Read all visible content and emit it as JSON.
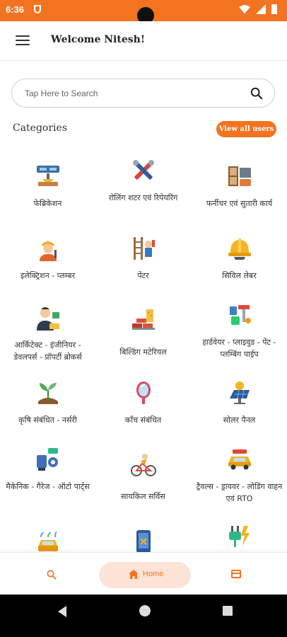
{
  "status": {
    "time": "6:36"
  },
  "header": {
    "title": "Welcome Nitesh!"
  },
  "search": {
    "placeholder": "Tap Here to Search"
  },
  "categories": {
    "title": "Categories",
    "view_all": "View all users",
    "items": [
      {
        "label": "फेब्रिकेशन",
        "icon": "fabrication-icon"
      },
      {
        "label": "रोलिंग शटर एवं रिपेयरिंग",
        "icon": "tools-icon"
      },
      {
        "label": "फर्नीचर एवं सुतारी कार्य",
        "icon": "furniture-icon"
      },
      {
        "label": "इलेक्ट्रिशन - प्लम्बर",
        "icon": "electrician-icon"
      },
      {
        "label": "पेंटर",
        "icon": "painter-icon"
      },
      {
        "label": "सिविल लेबर",
        "icon": "helmet-icon"
      },
      {
        "label": "आर्किटेक्ट - इंजीनियर - डेवलपर्स - प्रॉपर्टी ब्रोकर्स",
        "icon": "architect-icon"
      },
      {
        "label": "बिल्डिंग मटेरियल",
        "icon": "bricks-icon"
      },
      {
        "label": "हार्डवेयर - प्लाइवुड - पेंट - प्लम्बिंग पाईप",
        "icon": "hardware-icon"
      },
      {
        "label": "कृषि संबंधित - नर्सरी",
        "icon": "plant-icon"
      },
      {
        "label": "काँच संबंधित",
        "icon": "mirror-icon"
      },
      {
        "label": "सोलर पैनल",
        "icon": "solar-icon"
      },
      {
        "label": "मैकेनिक - गैरेज - ऑटो पार्ट्स",
        "icon": "mechanic-icon"
      },
      {
        "label": "सायकिल सर्विस",
        "icon": "cycle-icon"
      },
      {
        "label": "ट्रैवल्स - ड्रायवर - लोडिंग वाहन एवं RTO",
        "icon": "travel-icon"
      },
      {
        "label": "",
        "icon": "car-wash-icon"
      },
      {
        "label": "",
        "icon": "phone-repair-icon"
      },
      {
        "label": "",
        "icon": "plug-icon"
      }
    ]
  },
  "bottom_nav": {
    "home_label": "Home"
  },
  "colors": {
    "accent": "#f37321",
    "accent_light": "#fde3d6"
  }
}
